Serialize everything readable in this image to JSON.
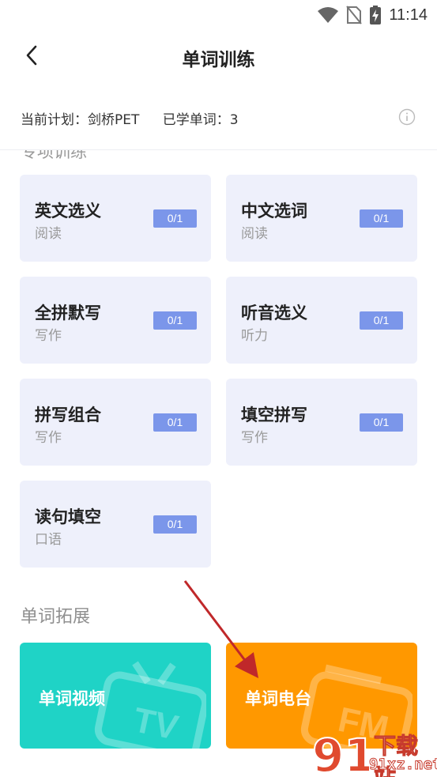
{
  "status_bar": {
    "time": "11:14"
  },
  "header": {
    "title": "单词训练"
  },
  "plan": {
    "current_plan": "当前计划：剑桥PET",
    "learned_words": "已学单词：3"
  },
  "training": {
    "heading_partial": "专项训练",
    "cards": [
      {
        "name": "英文选义",
        "type": "阅读",
        "progress": "0/1"
      },
      {
        "name": "中文选词",
        "type": "阅读",
        "progress": "0/1"
      },
      {
        "name": "全拼默写",
        "type": "写作",
        "progress": "0/1"
      },
      {
        "name": "听音选义",
        "type": "听力",
        "progress": "0/1"
      },
      {
        "name": "拼写组合",
        "type": "写作",
        "progress": "0/1"
      },
      {
        "name": "填空拼写",
        "type": "写作",
        "progress": "0/1"
      },
      {
        "name": "读句填空",
        "type": "口语",
        "progress": "0/1"
      }
    ]
  },
  "extension": {
    "title": "单词拓展",
    "items": [
      {
        "label": "单词视频",
        "color": "#1fd3c6",
        "icon": "tv-icon",
        "icon_text": "TV"
      },
      {
        "label": "单词电台",
        "color": "#ff9800",
        "icon": "radio-icon",
        "icon_text": "FM"
      }
    ]
  },
  "watermark": {
    "brand": "下载站",
    "domain": "91xz.net"
  },
  "colors": {
    "badge": "#7b96ea",
    "card_bg": "#eef0fb",
    "arrow": "#c0282a"
  }
}
